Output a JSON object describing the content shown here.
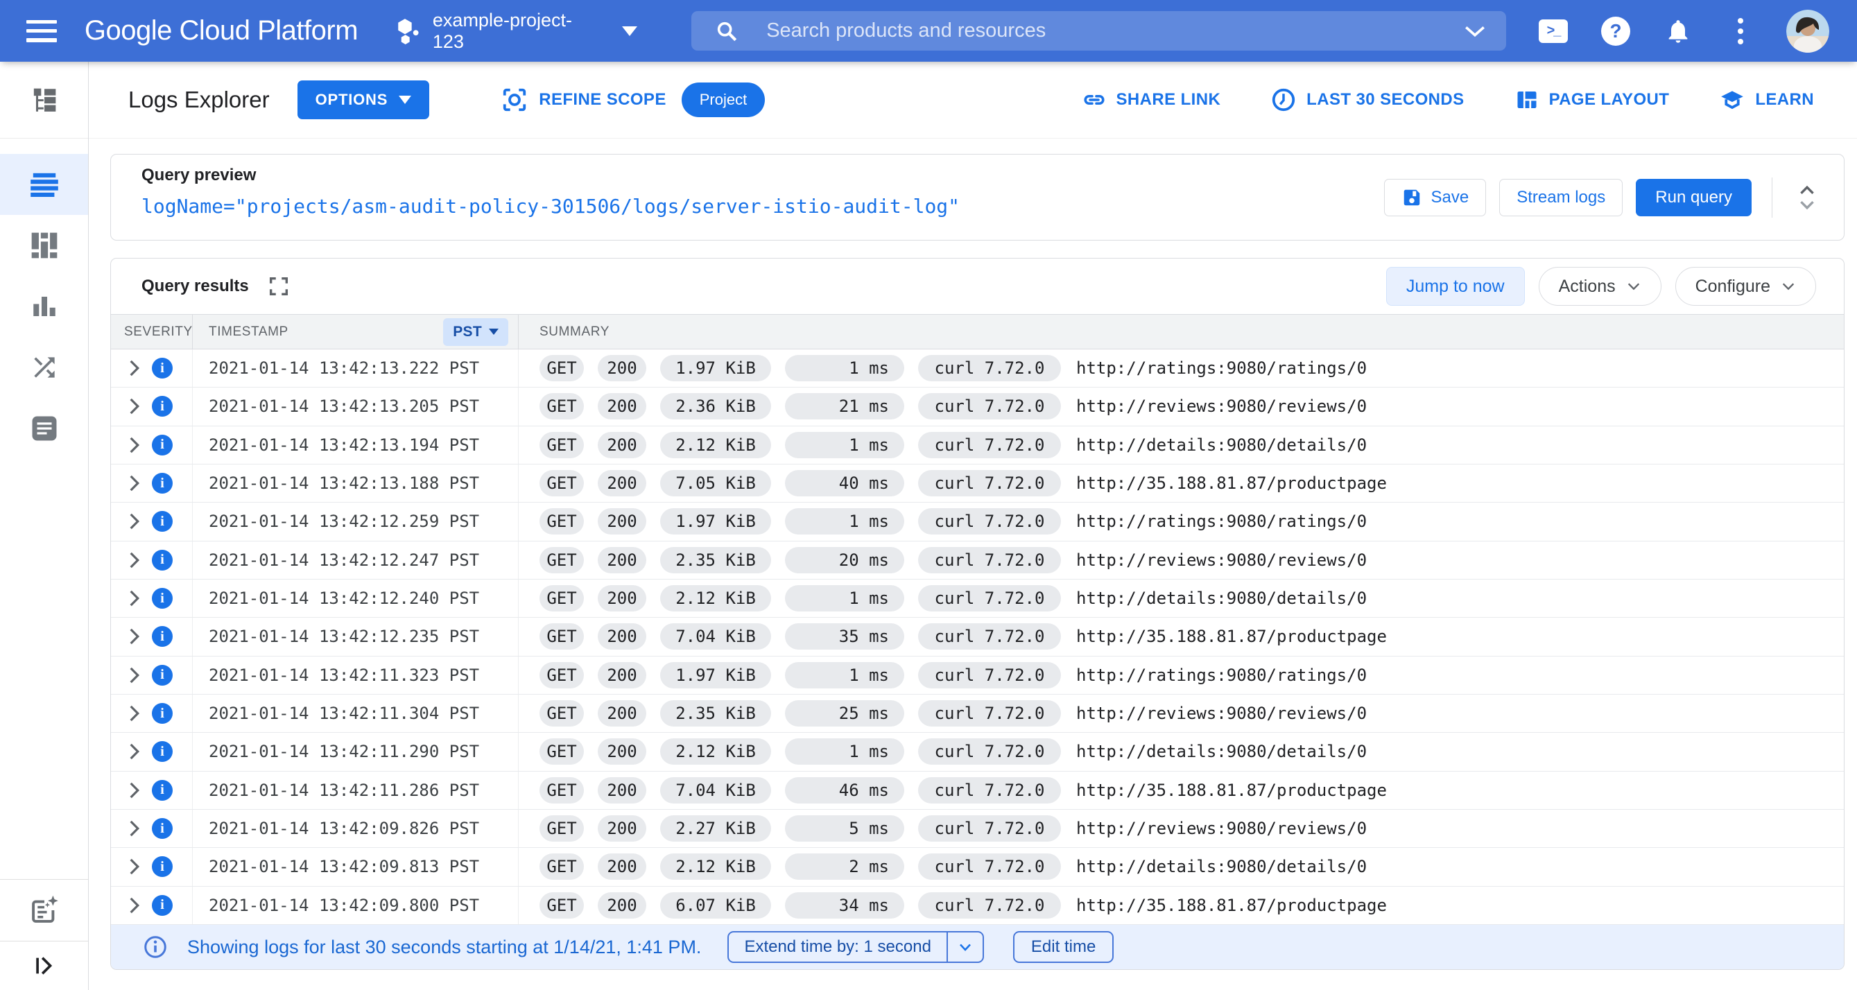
{
  "topbar": {
    "brand": "Google Cloud Platform",
    "project": "example-project-123",
    "search_placeholder": "Search products and resources",
    "icons": [
      "menu-icon",
      "project-hexagons-icon",
      "search-icon",
      "chevron-down-icon",
      "cloud-shell-icon",
      "help-icon",
      "notifications-bell-icon",
      "more-vertical-icon",
      "avatar"
    ]
  },
  "sidebar": {
    "icons": [
      "logs-explorer-icon",
      "logs-list-icon",
      "log-fields-icon",
      "histogram-icon",
      "trace-shuffle-icon",
      "documentation-icon",
      "release-notes-icon",
      "expand-panel-icon"
    ],
    "selected": "logs-list-icon"
  },
  "toolbar": {
    "title": "Logs Explorer",
    "options_label": "OPTIONS",
    "refine_scope_label": "REFINE SCOPE",
    "scope_badge": "Project",
    "share_link_label": "SHARE LINK",
    "time_range_label": "LAST 30 SECONDS",
    "page_layout_label": "PAGE LAYOUT",
    "learn_label": "LEARN"
  },
  "query_preview": {
    "title": "Query preview",
    "query": "logName=\"projects/asm-audit-policy-301506/logs/server-istio-audit-log\"",
    "save_label": "Save",
    "stream_label": "Stream logs",
    "run_label": "Run query"
  },
  "results": {
    "title": "Query results",
    "jump_label": "Jump to now",
    "actions_label": "Actions",
    "configure_label": "Configure",
    "columns": {
      "severity": "SEVERITY",
      "timestamp": "TIMESTAMP",
      "timezone": "PST",
      "summary": "SUMMARY"
    },
    "rows": [
      {
        "timestamp": "2021-01-14 13:42:13.222 PST",
        "method": "GET",
        "status": "200",
        "size": "1.97 KiB",
        "latency": "1 ms",
        "client": "curl 7.72.0",
        "url": "http://ratings:9080/ratings/0"
      },
      {
        "timestamp": "2021-01-14 13:42:13.205 PST",
        "method": "GET",
        "status": "200",
        "size": "2.36 KiB",
        "latency": "21 ms",
        "client": "curl 7.72.0",
        "url": "http://reviews:9080/reviews/0"
      },
      {
        "timestamp": "2021-01-14 13:42:13.194 PST",
        "method": "GET",
        "status": "200",
        "size": "2.12 KiB",
        "latency": "1 ms",
        "client": "curl 7.72.0",
        "url": "http://details:9080/details/0"
      },
      {
        "timestamp": "2021-01-14 13:42:13.188 PST",
        "method": "GET",
        "status": "200",
        "size": "7.05 KiB",
        "latency": "40 ms",
        "client": "curl 7.72.0",
        "url": "http://35.188.81.87/productpage"
      },
      {
        "timestamp": "2021-01-14 13:42:12.259 PST",
        "method": "GET",
        "status": "200",
        "size": "1.97 KiB",
        "latency": "1 ms",
        "client": "curl 7.72.0",
        "url": "http://ratings:9080/ratings/0"
      },
      {
        "timestamp": "2021-01-14 13:42:12.247 PST",
        "method": "GET",
        "status": "200",
        "size": "2.35 KiB",
        "latency": "20 ms",
        "client": "curl 7.72.0",
        "url": "http://reviews:9080/reviews/0"
      },
      {
        "timestamp": "2021-01-14 13:42:12.240 PST",
        "method": "GET",
        "status": "200",
        "size": "2.12 KiB",
        "latency": "1 ms",
        "client": "curl 7.72.0",
        "url": "http://details:9080/details/0"
      },
      {
        "timestamp": "2021-01-14 13:42:12.235 PST",
        "method": "GET",
        "status": "200",
        "size": "7.04 KiB",
        "latency": "35 ms",
        "client": "curl 7.72.0",
        "url": "http://35.188.81.87/productpage"
      },
      {
        "timestamp": "2021-01-14 13:42:11.323 PST",
        "method": "GET",
        "status": "200",
        "size": "1.97 KiB",
        "latency": "1 ms",
        "client": "curl 7.72.0",
        "url": "http://ratings:9080/ratings/0"
      },
      {
        "timestamp": "2021-01-14 13:42:11.304 PST",
        "method": "GET",
        "status": "200",
        "size": "2.35 KiB",
        "latency": "25 ms",
        "client": "curl 7.72.0",
        "url": "http://reviews:9080/reviews/0"
      },
      {
        "timestamp": "2021-01-14 13:42:11.290 PST",
        "method": "GET",
        "status": "200",
        "size": "2.12 KiB",
        "latency": "1 ms",
        "client": "curl 7.72.0",
        "url": "http://details:9080/details/0"
      },
      {
        "timestamp": "2021-01-14 13:42:11.286 PST",
        "method": "GET",
        "status": "200",
        "size": "7.04 KiB",
        "latency": "46 ms",
        "client": "curl 7.72.0",
        "url": "http://35.188.81.87/productpage"
      },
      {
        "timestamp": "2021-01-14 13:42:09.826 PST",
        "method": "GET",
        "status": "200",
        "size": "2.27 KiB",
        "latency": "5 ms",
        "client": "curl 7.72.0",
        "url": "http://reviews:9080/reviews/0"
      },
      {
        "timestamp": "2021-01-14 13:42:09.813 PST",
        "method": "GET",
        "status": "200",
        "size": "2.12 KiB",
        "latency": "2 ms",
        "client": "curl 7.72.0",
        "url": "http://details:9080/details/0"
      },
      {
        "timestamp": "2021-01-14 13:42:09.800 PST",
        "method": "GET",
        "status": "200",
        "size": "6.07 KiB",
        "latency": "34 ms",
        "client": "curl 7.72.0",
        "url": "http://35.188.81.87/productpage"
      }
    ]
  },
  "footer": {
    "message": "Showing logs for last 30 seconds starting at 1/14/21, 1:41 PM.",
    "extend_label": "Extend time by: 1 second",
    "edit_label": "Edit time"
  },
  "colors": {
    "topbar": "#3d6fd6",
    "accent": "#1a73e8",
    "lightblue": "#e8f0fe",
    "chipblue": "#d2e3fc",
    "darkblue": "#174ea6",
    "badge": "#e8eaed",
    "tableheader": "#f1f3f4",
    "border": "#dadce0",
    "text": "#202124",
    "secondary": "#5f6368",
    "footertext": "#1967d2"
  }
}
